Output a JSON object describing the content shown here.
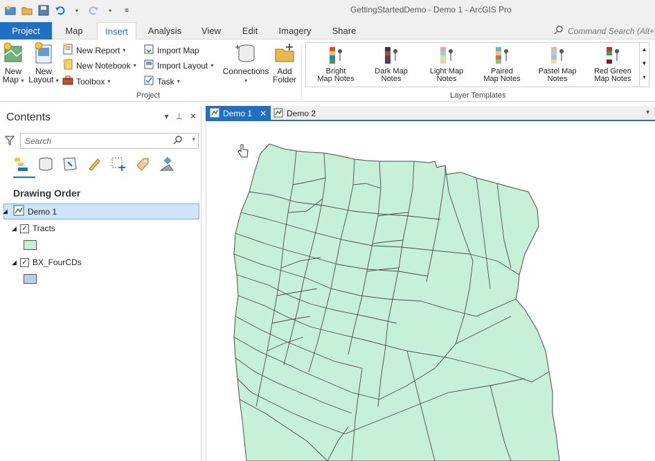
{
  "window": {
    "title": "GettingStartedDemo - Demo 1 - ArcGIS Pro",
    "qat": [
      "new-project-icon",
      "open-project-icon",
      "save-icon",
      "undo-icon",
      "redo-icon",
      "customize-icon"
    ]
  },
  "ribbon_tabs": [
    "Project",
    "Map",
    "Insert",
    "Analysis",
    "View",
    "Edit",
    "Imagery",
    "Share"
  ],
  "active_tab": "Insert",
  "command_search": {
    "placeholder": "Command Search (Alt+"
  },
  "ribbon": {
    "new_map": "New\nMap",
    "new_layout": "New\nLayout",
    "new_report": "New Report",
    "new_notebook": "New Notebook",
    "toolbox": "Toolbox",
    "import_map": "Import Map",
    "import_layout": "Import Layout",
    "task": "Task",
    "connections": "Connections",
    "add_folder": "Add\nFolder",
    "project_group": "Project",
    "layer_templates_group": "Layer Templates",
    "templates": [
      {
        "line1": "Bright",
        "line2": "Map Notes"
      },
      {
        "line1": "Dark Map",
        "line2": "Notes"
      },
      {
        "line1": "Light Map",
        "line2": "Notes"
      },
      {
        "line1": "Paired",
        "line2": "Map Notes"
      },
      {
        "line1": "Pastel Map",
        "line2": "Notes"
      },
      {
        "line1": "Red Green",
        "line2": "Map Notes"
      }
    ]
  },
  "contents": {
    "title": "Contents",
    "search_placeholder": "Search",
    "section": "Drawing Order",
    "map_name": "Demo 1",
    "layers": [
      {
        "name": "Tracts",
        "checked": true,
        "color": "#c6f1d8"
      },
      {
        "name": "BX_FourCDs",
        "checked": true,
        "color": "#b8cdf0"
      }
    ]
  },
  "view_tabs": [
    {
      "label": "Demo 1",
      "active": true
    },
    {
      "label": "Demo 2",
      "active": false
    }
  ],
  "map": {
    "fill_color": "#c6f1d8",
    "outline_color": "#4a4a4a"
  }
}
